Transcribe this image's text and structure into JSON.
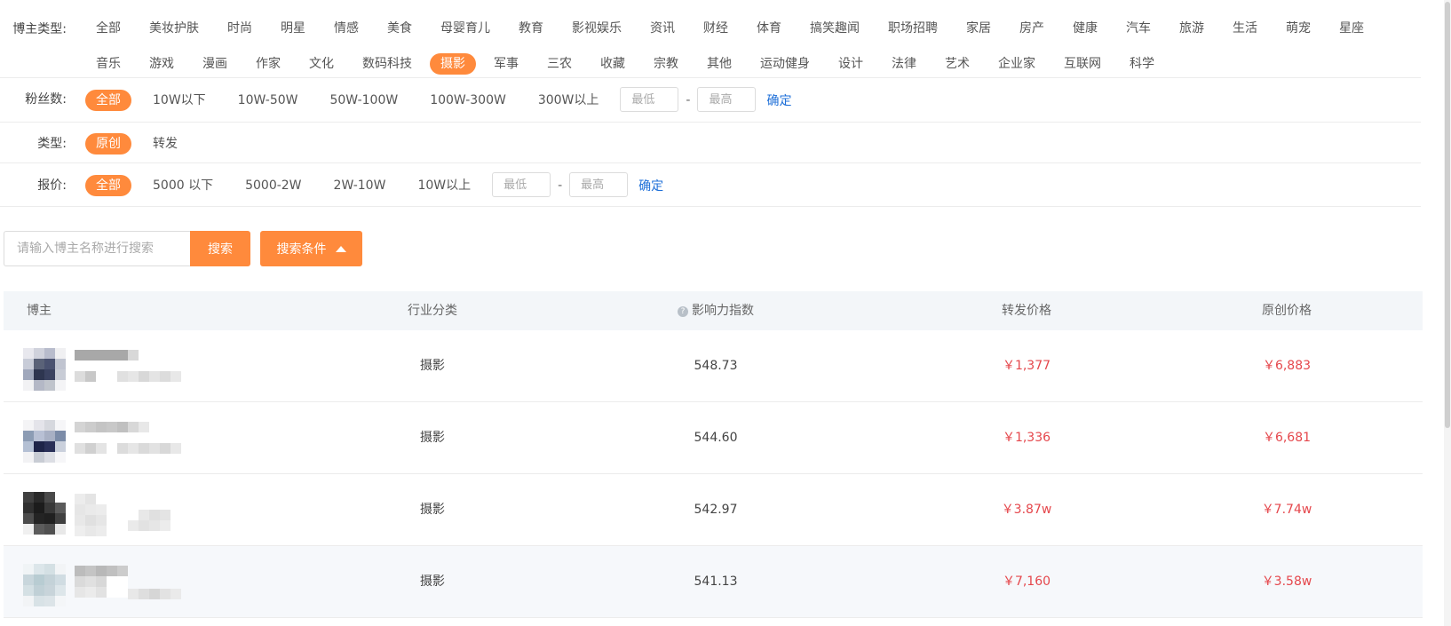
{
  "filters": {
    "blogger_type": {
      "label": "博主类型:",
      "options": [
        "全部",
        "美妆护肤",
        "时尚",
        "明星",
        "情感",
        "美食",
        "母婴育儿",
        "教育",
        "影视娱乐",
        "资讯",
        "财经",
        "体育",
        "搞笑趣闻",
        "职场招聘",
        "家居",
        "房产",
        "健康",
        "汽车",
        "旅游",
        "生活",
        "萌宠",
        "星座",
        "音乐",
        "游戏",
        "漫画",
        "作家",
        "文化",
        "数码科技",
        "摄影",
        "军事",
        "三农",
        "收藏",
        "宗教",
        "其他",
        "运动健身",
        "设计",
        "法律",
        "艺术",
        "企业家",
        "互联网",
        "科学"
      ],
      "active": "摄影"
    },
    "fans": {
      "label": "粉丝数:",
      "options": [
        "全部",
        "10W以下",
        "10W-50W",
        "50W-100W",
        "100W-300W",
        "300W以上"
      ],
      "active": "全部",
      "min_placeholder": "最低",
      "max_placeholder": "最高",
      "dash": "-",
      "confirm": "确定"
    },
    "kind": {
      "label": "类型:",
      "options": [
        "原创",
        "转发"
      ],
      "active": "原创"
    },
    "price": {
      "label": "报价:",
      "options": [
        "全部",
        "5000 以下",
        "5000-2W",
        "2W-10W",
        "10W以上"
      ],
      "active": "全部",
      "min_placeholder": "最低",
      "max_placeholder": "最高",
      "dash": "-",
      "confirm": "确定"
    }
  },
  "search": {
    "placeholder": "请输入博主名称进行搜索",
    "button": "搜索",
    "conditions_button": "搜索条件"
  },
  "table": {
    "headers": [
      "博主",
      "行业分类",
      "影响力指数",
      "转发价格",
      "原创价格"
    ],
    "rows": [
      {
        "category": "摄影",
        "index": "548.73",
        "repost_price": "￥1,377",
        "original_price": "￥6,883"
      },
      {
        "category": "摄影",
        "index": "544.60",
        "repost_price": "￥1,336",
        "original_price": "￥6,681"
      },
      {
        "category": "摄影",
        "index": "542.97",
        "repost_price": "￥3.87w",
        "original_price": "￥7.74w"
      },
      {
        "category": "摄影",
        "index": "541.13",
        "repost_price": "￥7,160",
        "original_price": "￥3.58w"
      }
    ]
  },
  "colors": {
    "accent": "#ff8a3c",
    "price": "#e5474c",
    "link": "#1e6fd8"
  }
}
